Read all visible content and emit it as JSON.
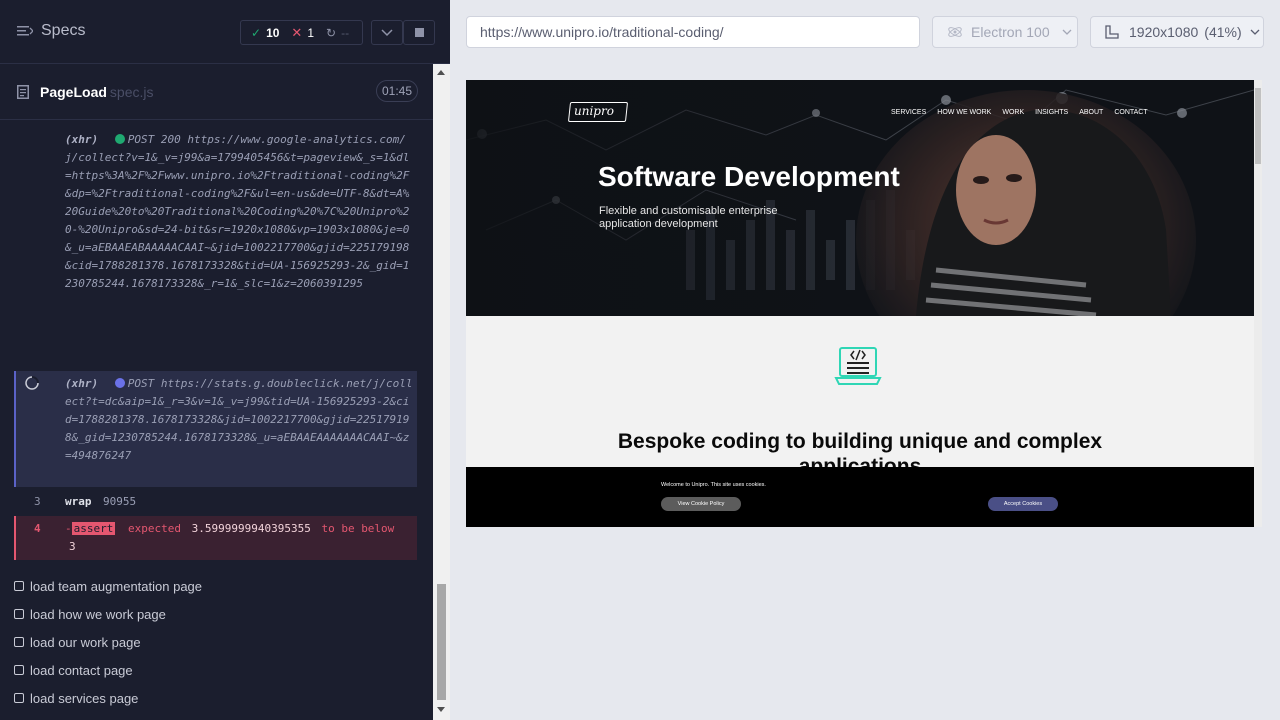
{
  "sidebar": {
    "title": "Specs",
    "stats": {
      "passed": "10",
      "failed": "1",
      "pending": "--"
    },
    "spec": {
      "name": "PageLoad",
      "file": "spec.js",
      "time": "01:45"
    },
    "commands": [
      {
        "method": "(xhr)",
        "status_color": "#1fa971",
        "request": "POST 200 https://www.google-analytics.com/j/collect?v=1&_v=j99&a=1799405456&t=pageview&_s=1&dl=https%3A%2F%2Fwww.unipro.io%2Ftraditional-coding%2F&dp=%2Ftraditional-coding%2F&ul=en-us&de=UTF-8&dt=A%20Guide%20to%20Traditional%20Coding%20%7C%20Unipro%20-%20Unipro&sd=24-bit&sr=1920x1080&vp=1903x1080&je=0&_u=aEBAAEABAAAAACAAI~&jid=1002217700&gjid=225179198&cid=1788281378.1678173328&tid=UA-156925293-2&_gid=1230785244.1678173328&_r=1&_slc=1&z=2060391295"
      },
      {
        "method": "(xhr)",
        "status_color": "#6b72e8",
        "request": "POST https://stats.g.doubleclick.net/j/collect?t=dc&aip=1&_r=3&v=1&_v=j99&tid=UA-156925293-2&cid=1788281378.1678173328&jid=1002217700&gjid=225179198&_gid=1230785244.1678173328&_u=aEBAAEAAAAAAACAAI~&z=494876247"
      },
      {
        "number": "3",
        "name": "wrap",
        "value": "90955"
      },
      {
        "number": "4",
        "prefix": "-",
        "name": "assert",
        "message": "expected",
        "expected": "3.5999999940395355",
        "message2": "to be below",
        "limit": "3"
      }
    ],
    "tests": [
      "load team augmentation page",
      "load how we work page",
      "load our work page",
      "load contact page",
      "load services page"
    ]
  },
  "toolbar": {
    "url": "https://www.unipro.io/traditional-coding/",
    "browser": "Electron 100",
    "viewport": "1920x1080",
    "scale": "(41%)"
  },
  "aut": {
    "logo": "unipro",
    "nav": [
      "SERVICES",
      "HOW WE WORK",
      "WORK",
      "INSIGHTS",
      "ABOUT",
      "CONTACT"
    ],
    "hero_title": "Software Development",
    "hero_subtitle_1": "Flexible and customisable enterprise",
    "hero_subtitle_2": "application development",
    "section_title_1": "Bespoke coding to building unique and complex",
    "section_title_2": "applications",
    "cookie_text": "Welcome to Unipro. This site uses cookies.",
    "cookie_policy_btn": "View Cookie Policy",
    "cookie_accept_btn": "Accept Cookies"
  },
  "colors": {
    "accent": "#5b62c7",
    "fail": "#e45770",
    "pass": "#1fa971",
    "sidebar_bg": "#1b1e2e"
  }
}
